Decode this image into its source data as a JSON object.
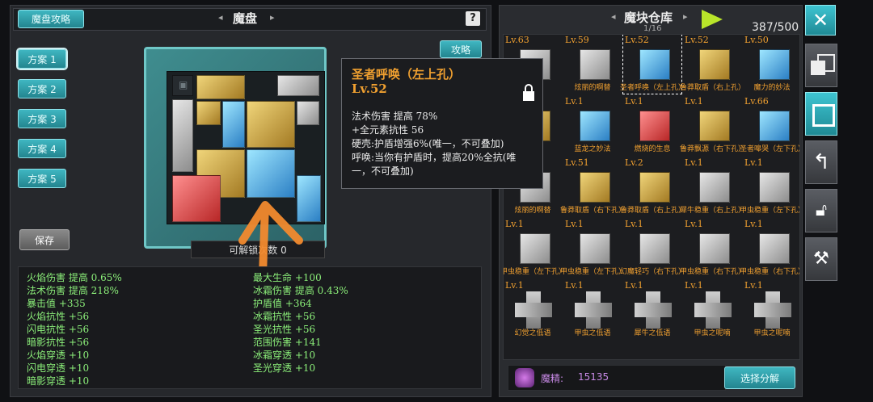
{
  "left": {
    "guide_btn": "魔盘攻略",
    "title": "魔盘",
    "help_icon": "?",
    "strategy_btn": "攻略",
    "plans": [
      "方案 1",
      "方案 2",
      "方案 3",
      "方案 4",
      "方案 5"
    ],
    "save_btn": "保存",
    "unlock_label": "可解锁次数 0",
    "stats_left": [
      "火焰伤害 提高 0.65%",
      "法术伤害 提高 218%",
      "暴击值 +335",
      "火焰抗性 +56",
      "闪电抗性 +56",
      "暗影抗性 +56",
      "火焰穿透 +10",
      "闪电穿透 +10",
      "暗影穿透 +10"
    ],
    "stats_right": [
      "最大生命 +100",
      "冰霜伤害 提高 0.43%",
      "护盾值 +364",
      "冰霜抗性 +56",
      "圣光抗性 +56",
      "范围伤害 +141",
      "冰霜穿透 +10",
      "圣光穿透 +10"
    ]
  },
  "tooltip": {
    "name": "圣者呼唤（左上孔）",
    "level": "Lv.52",
    "lines": [
      "法术伤害 提高 78%",
      "+全元素抗性 56",
      "硬壳:护盾增强6%(唯一，不可叠加)",
      "呼唤:当你有护盾时，提高20%全抗(唯",
      "一，不可叠加)"
    ]
  },
  "right": {
    "title": "魔块仓库",
    "page": "1/16",
    "count": "387/500",
    "essence_label": "魔精:",
    "essence_value": "15135",
    "decompose_btn": "选择分解",
    "rows": [
      [
        {
          "lv": "Lv.63",
          "name": "",
          "color": "silver"
        },
        {
          "lv": "Lv.59",
          "name": "炫丽的啊替",
          "color": "silver"
        },
        {
          "lv": "Lv.52",
          "name": "圣者呼唤（左上孔）",
          "color": "blue"
        },
        {
          "lv": "Lv.52",
          "name": "鲁莽取盾（右上孔）",
          "color": "gold"
        },
        {
          "lv": "Lv.50",
          "name": "魔力的妙法",
          "color": "blue"
        }
      ],
      [
        {
          "lv": "Lv.1",
          "name": "捷",
          "color": "gold"
        },
        {
          "lv": "Lv.1",
          "name": "蓝龙之妙法",
          "color": "blue"
        },
        {
          "lv": "Lv.1",
          "name": "燃烧的生息",
          "color": "red"
        },
        {
          "lv": "Lv.1",
          "name": "鲁莽飘源（右下孔）",
          "color": "gold"
        },
        {
          "lv": "Lv.66",
          "name": "圣者嗥哭（左下孔）",
          "color": "blue"
        }
      ],
      [
        {
          "lv": "",
          "name": "炫丽的啊替",
          "color": "silver"
        },
        {
          "lv": "Lv.51",
          "name": "鲁莽取盾（右下孔）",
          "color": "gold"
        },
        {
          "lv": "Lv.2",
          "name": "鲁莽取盾（右上孔）",
          "color": "gold"
        },
        {
          "lv": "Lv.1",
          "name": "犀牛稳重（右上孔）",
          "color": "silver"
        },
        {
          "lv": "Lv.1",
          "name": "甲虫稳重（左下孔）",
          "color": "silver"
        }
      ],
      [
        {
          "lv": "Lv.1",
          "name": "甲虫稳重（左下孔）",
          "color": "silver"
        },
        {
          "lv": "Lv.1",
          "name": "甲虫稳重（左下孔）",
          "color": "silver"
        },
        {
          "lv": "Lv.1",
          "name": "幻魔轻巧（右下孔）",
          "color": "silver"
        },
        {
          "lv": "Lv.1",
          "name": "甲虫稳重（右下孔）",
          "color": "silver"
        },
        {
          "lv": "Lv.1",
          "name": "甲虫稳重（右下孔）",
          "color": "silver"
        }
      ],
      [
        {
          "lv": "Lv.1",
          "name": "幻觉之低语",
          "color": "cross"
        },
        {
          "lv": "Lv.1",
          "name": "甲虫之低语",
          "color": "cross"
        },
        {
          "lv": "Lv.1",
          "name": "犀牛之低语",
          "color": "cross"
        },
        {
          "lv": "Lv.1",
          "name": "甲虫之呢喃",
          "color": "cross"
        },
        {
          "lv": "Lv.1",
          "name": "甲虫之呢喃",
          "color": "cross"
        }
      ]
    ]
  },
  "colors": {
    "accent": "#3fb6c1",
    "orange": "#f0a030",
    "green": "#8cf07a"
  }
}
